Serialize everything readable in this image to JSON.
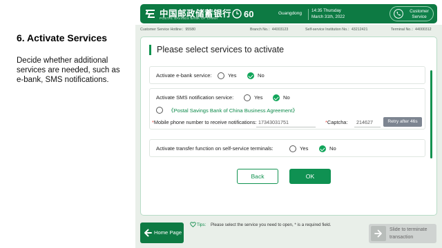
{
  "guide": {
    "step_title": "6. Activate Services",
    "step_description": "Decide whether additional services are needed, such as e-bank,  SMS notifications."
  },
  "header": {
    "brand_cn": "中国邮政储蓄银行",
    "brand_en": "POSTAL SAVINGS BANK OF CHINA",
    "countdown": "60",
    "region": "Guangdong",
    "time": "14:35 Thursday",
    "date": "March 31th, 2022",
    "customer_service_label": "Customer Service",
    "brand_color": "#0d7a43"
  },
  "infobar": {
    "hotline": "Customer Service Hotline：95580",
    "branch": "Branch No.：44003123",
    "institution": "Self-service Institution No.：43212421",
    "terminal": "Terminal No.：44000312"
  },
  "form": {
    "title": "Please select services to activate",
    "ebank": {
      "question": "Activate e-bank service:",
      "yes": "Yes",
      "no": "No",
      "selected": "No"
    },
    "sms": {
      "question": "Activate SMS notification service:",
      "yes": "Yes",
      "no": "No",
      "selected": "No",
      "agreement_checked": false,
      "agreement": "《Postal Savings Bank of China Business Agreement》",
      "phone_required": "*",
      "phone_label": "Mobile phone number to receive notifications:",
      "phone_value": "17343031751",
      "captcha_required": "*",
      "captcha_label": "Captcha:",
      "captcha_value": "214627",
      "retry_label": "Retry after 46s"
    },
    "transfer": {
      "question": "Activate transfer function on self-service terminals:",
      "yes": "Yes",
      "no": "No",
      "selected": "No"
    },
    "back_label": "Back",
    "ok_label": "OK"
  },
  "footer": {
    "home_label": "Home Page",
    "tips_label": "Tips:",
    "tips_text": "Please select the service you need to open, * is a required field.",
    "slide_label": "Slide to terminate transaction"
  },
  "icons": {
    "logo": "postal-savings-logo-icon",
    "timer": "clock-icon",
    "customer_service": "phone-icon",
    "home": "arrow-left-icon",
    "tips": "heart-icon",
    "slide": "arrow-right-icon"
  }
}
